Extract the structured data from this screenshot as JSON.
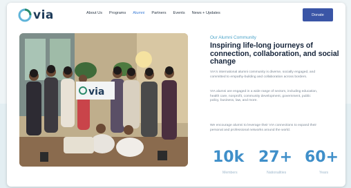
{
  "brand": {
    "logo_text": "via",
    "colors": {
      "navy": "#1f3c5a",
      "accent": "#3a7bd5",
      "button": "#3a55a6",
      "stat": "#3f8fc9",
      "kicker": "#4aa3c8"
    }
  },
  "nav": {
    "items": [
      {
        "label": "About Us"
      },
      {
        "label": "Programs"
      },
      {
        "label": "Alumni"
      },
      {
        "label": "Partners"
      },
      {
        "label": "Events"
      },
      {
        "label": "News + Updates"
      }
    ],
    "donate_label": "Donate"
  },
  "photo": {
    "banner_text": "via",
    "description_icon": "group-photo"
  },
  "content": {
    "kicker": "Our Alumni Community",
    "heading": "Inspiring life-long journeys of connection, collaboration, and social change",
    "paragraphs": [
      "VIA's international alumni community is diverse, socially engaged, and committed to empathy-building and collaboration across borders.",
      "VIA alumni are engaged in a wide range of sectors, including education, health care, nonprofit, community development, government, public policy, business, law, and more.",
      "We encourage alumni to leverage their VIA connections to expand their personal and professional networks around the world."
    ]
  },
  "stats": [
    {
      "value": "10k",
      "label": "Members"
    },
    {
      "value": "27+",
      "label": "Nationalities"
    },
    {
      "value": "60+",
      "label": "Years"
    }
  ]
}
